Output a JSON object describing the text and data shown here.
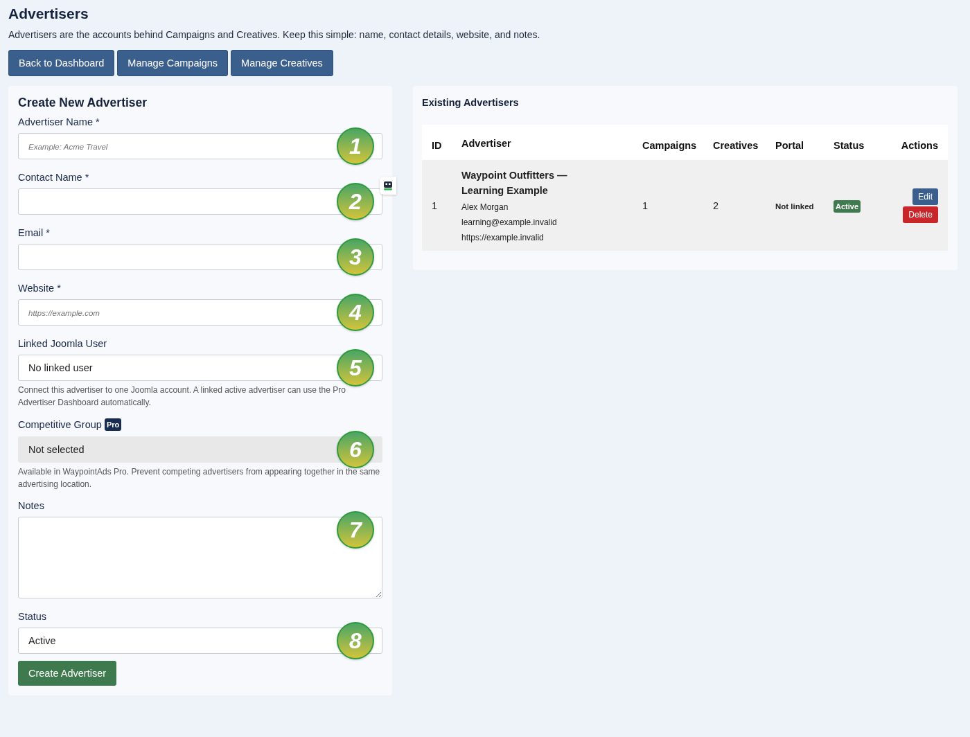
{
  "page": {
    "title": "Advertisers",
    "description": "Advertisers are the accounts behind Campaigns and Creatives. Keep this simple: name, contact details, website, and notes."
  },
  "nav_buttons": [
    "Back to Dashboard",
    "Manage Campaigns",
    "Manage Creatives"
  ],
  "form": {
    "title": "Create New Advertiser",
    "fields": [
      {
        "kind": "text",
        "label": "Advertiser Name *",
        "placeholder": "Example: Acme Travel",
        "marker": "1"
      },
      {
        "kind": "text",
        "label": "Contact Name *",
        "marker": "2",
        "helper_icon": true
      },
      {
        "kind": "text",
        "label": "Email *",
        "marker": "3"
      },
      {
        "kind": "text",
        "label": "Website *",
        "placeholder": "https://example.com",
        "marker": "4"
      },
      {
        "kind": "select",
        "label": "Linked Joomla User",
        "value": "No linked user",
        "hint": "Connect this advertiser to one Joomla account. A linked active advertiser can use the Pro Advertiser Dashboard automatically.",
        "marker": "5"
      },
      {
        "kind": "select",
        "label": "Competitive Group",
        "badge": "Pro",
        "value": "Not selected",
        "disabled": true,
        "hint": "Available in WaypointAds Pro. Prevent competing advertisers from appearing together in the same advertising location.",
        "marker": "6"
      },
      {
        "kind": "textarea",
        "label": "Notes",
        "marker": "7"
      },
      {
        "kind": "select",
        "label": "Status",
        "value": "Active",
        "marker": "8"
      }
    ],
    "submit": "Create Advertiser"
  },
  "table": {
    "title": "Existing Advertisers",
    "columns": [
      "ID",
      "Advertiser",
      "Campaigns",
      "Creatives",
      "Portal",
      "Status",
      "Actions"
    ],
    "rows": [
      {
        "id": "1",
        "name": "Waypoint Outfitters — Learning Example",
        "contact": "Alex Morgan",
        "email": "learning@example.invalid",
        "website": "https://example.invalid",
        "campaigns": "1",
        "creatives": "2",
        "portal": "Not linked",
        "status": "Active",
        "actions": [
          "Edit",
          "Delete"
        ]
      }
    ]
  }
}
